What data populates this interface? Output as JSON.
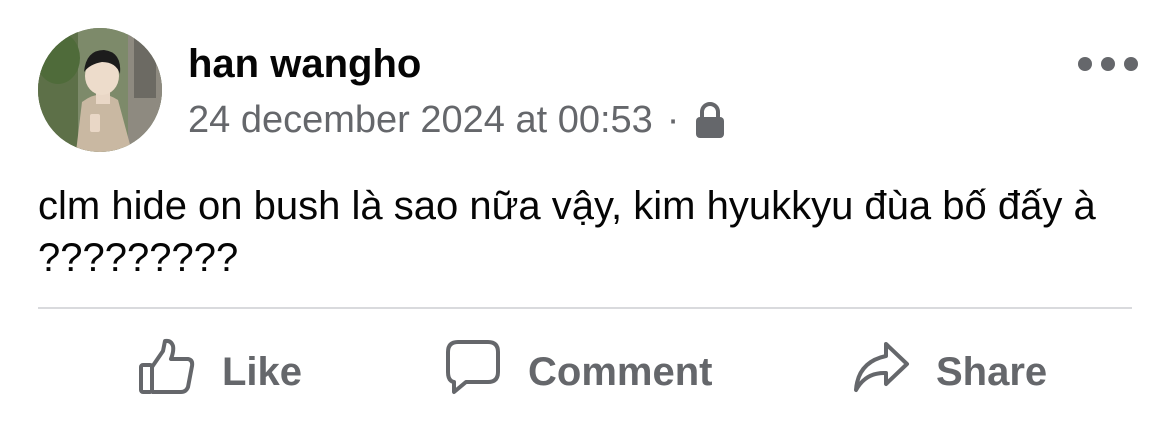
{
  "post": {
    "author_name": "han wangho",
    "timestamp": "24 december 2024 at 00:53",
    "separator": "·",
    "privacy_icon": "lock-icon",
    "more_icon": "more-options-icon",
    "message": "clm hide on bush là sao nữa vậy, kim hyukkyu đùa bố đấy à ?????????"
  },
  "actions": {
    "like": {
      "label": "Like",
      "icon": "thumbs-up-icon"
    },
    "comment": {
      "label": "Comment",
      "icon": "comment-icon"
    },
    "share": {
      "label": "Share",
      "icon": "share-icon"
    }
  },
  "colors": {
    "text_primary": "#050505",
    "text_secondary": "#65676b",
    "divider": "#d9dadd",
    "background": "#ffffff"
  }
}
